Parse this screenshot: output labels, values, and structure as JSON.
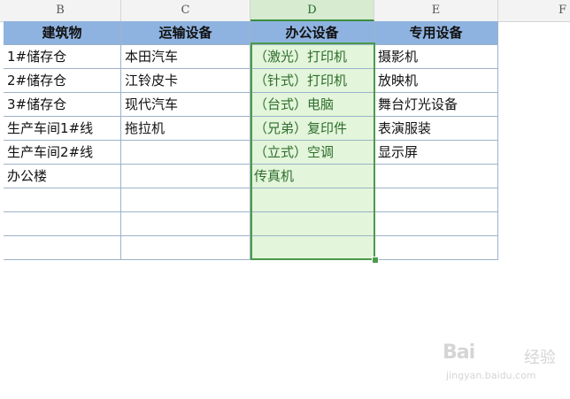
{
  "column_headers": [
    "B",
    "C",
    "D",
    "E",
    "F"
  ],
  "selected_column": "D",
  "table": {
    "headers": [
      "建筑物",
      "运输设备",
      "办公设备",
      "专用设备"
    ],
    "rows": [
      [
        "1#储存仓",
        "本田汽车",
        "（激光）打印机",
        "摄影机"
      ],
      [
        "2#储存仓",
        "江铃皮卡",
        "（针式）打印机",
        "放映机"
      ],
      [
        "3#储存仓",
        "现代汽车",
        "（台式）电脑",
        "舞台灯光设备"
      ],
      [
        "生产车间1#线",
        "拖拉机",
        "（兄弟）复印件",
        "表演服装"
      ],
      [
        "生产车间2#线",
        "",
        "（立式）空调",
        "显示屏"
      ],
      [
        "办公楼",
        "",
        "传真机",
        ""
      ],
      [
        "",
        "",
        "",
        ""
      ],
      [
        "",
        "",
        "",
        ""
      ],
      [
        "",
        "",
        "",
        ""
      ]
    ]
  },
  "watermark": {
    "brand": "Bai",
    "cn": "经验",
    "url": "jingyan.baidu.com"
  },
  "colors": {
    "header_fill": "#8fb3e0",
    "selection_fill": "#e3f5da",
    "selection_border": "#4a9a4a"
  }
}
